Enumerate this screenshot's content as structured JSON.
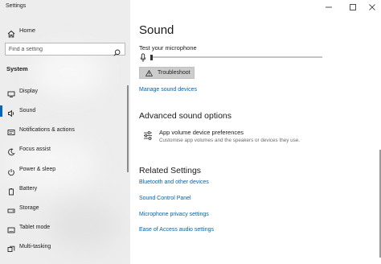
{
  "window": {
    "title": "Settings",
    "minimize_glyph": "minimize-icon",
    "maximize_glyph": "maximize-icon",
    "close_glyph": "close-icon"
  },
  "sidebar": {
    "home_label": "Home",
    "search_placeholder": "Find a setting",
    "section_label": "System",
    "items": [
      {
        "label": "Display",
        "icon": "display-icon"
      },
      {
        "label": "Sound",
        "icon": "speaker-icon",
        "active": true
      },
      {
        "label": "Notifications & actions",
        "icon": "notifications-icon"
      },
      {
        "label": "Focus assist",
        "icon": "moon-icon"
      },
      {
        "label": "Power & sleep",
        "icon": "power-icon"
      },
      {
        "label": "Battery",
        "icon": "battery-icon"
      },
      {
        "label": "Storage",
        "icon": "storage-icon"
      },
      {
        "label": "Tablet mode",
        "icon": "tablet-icon"
      },
      {
        "label": "Multi-tasking",
        "icon": "multitasking-icon"
      }
    ]
  },
  "main": {
    "title": "Sound",
    "mic_test_label": "Test your microphone",
    "mic_level": 0.0,
    "troubleshoot_label": "Troubleshoot",
    "manage_devices_link": "Manage sound devices",
    "advanced_heading": "Advanced sound options",
    "app_volume_title": "App volume  device preferences",
    "app_volume_desc": "Customise app volumes and the speakers or devices they use.",
    "related_heading": "Related Settings",
    "related_links": [
      "Bluetooth and other devices",
      "Sound Control Panel",
      "Microphone privacy settings",
      "Ease of Access audio settings"
    ]
  },
  "colors": {
    "accent": "#0067c0",
    "link": "#0063b1",
    "sidebar_bg": "#ededed"
  }
}
